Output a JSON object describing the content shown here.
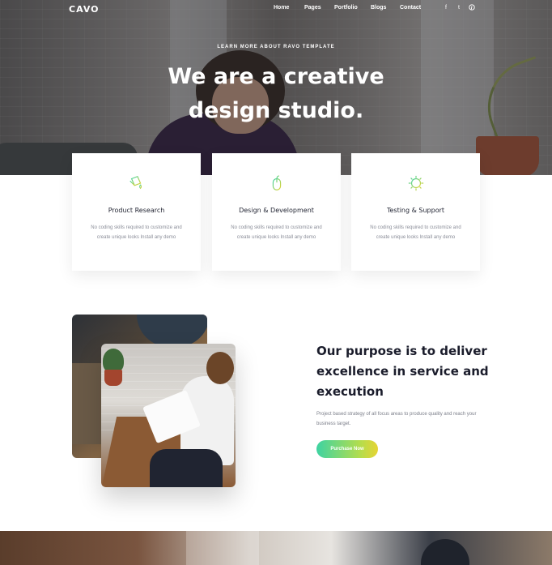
{
  "brand": {
    "logo": "CAVO"
  },
  "nav": {
    "links": [
      "Home",
      "Pages",
      "Portfolio",
      "Blogs",
      "Contact"
    ],
    "social": [
      "f",
      "t",
      "p"
    ]
  },
  "hero": {
    "kicker": "LEARN MORE ABOUT RAVO TEMPLATE",
    "title_line1": "We are a creative",
    "title_line2": "design studio."
  },
  "services": [
    {
      "title": "Product Research",
      "text": "No coding skills required to customize and create unique looks Install any demo",
      "icon": "paint-bucket-icon"
    },
    {
      "title": "Design & Development",
      "text": "No coding skills required to customize and create unique looks Install any demo",
      "icon": "mouse-icon"
    },
    {
      "title": "Testing & Support",
      "text": "No coding skills required to customize and create unique looks Install any demo",
      "icon": "gear-icon"
    }
  ],
  "about": {
    "title_line1": "Our purpose is to deliver",
    "title_line2": "excellence in service and",
    "title_line3": "execution",
    "text": "Project based strategy of all focus areas to produce quality and reach your business target.",
    "cta_label": "Purchase Now"
  },
  "colors": {
    "accent_green": "#3ed3a2",
    "accent_yellow": "#e6d433",
    "heading": "#1a1c2b",
    "body_text": "#7b7e89"
  }
}
